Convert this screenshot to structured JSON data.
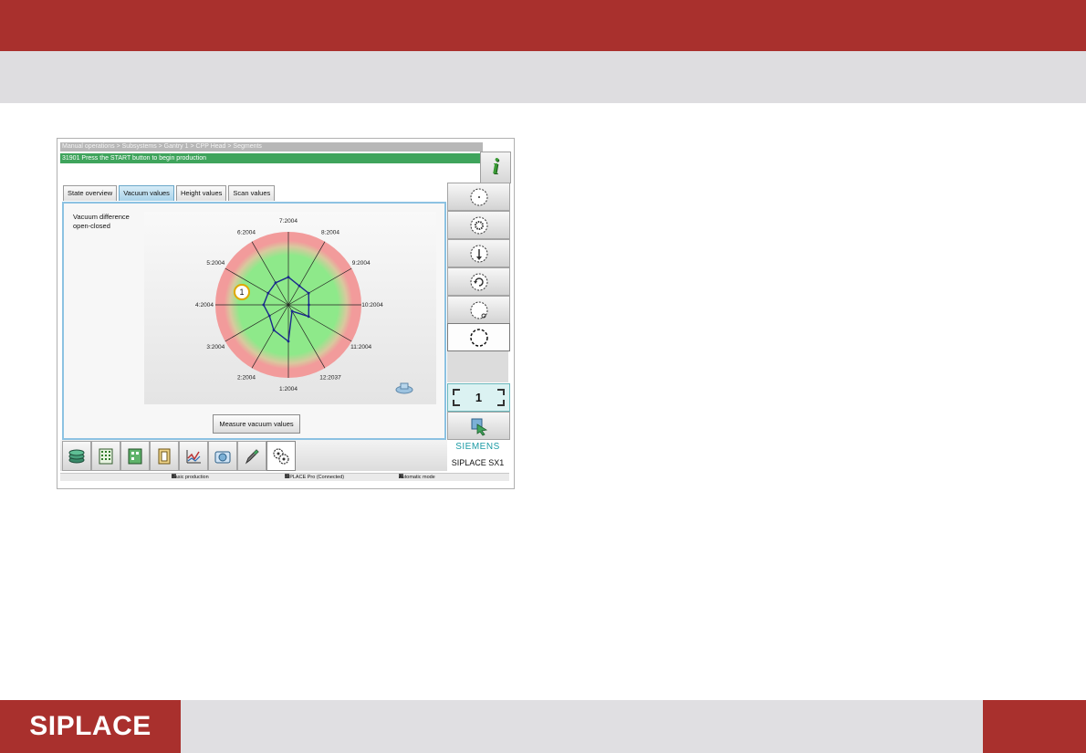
{
  "brand": {
    "logo_text": "SIPLACE",
    "accent": "#a9302d"
  },
  "screen": {
    "breadcrumb": "Manual operations > Subsystems > Gantry 1 > CPP Head > Segments",
    "status_message": "31901 Press the START button to begin production",
    "info_button_label": "i",
    "tabs": [
      {
        "label": "State overview",
        "active": false
      },
      {
        "label": "Vacuum values",
        "active": true
      },
      {
        "label": "Height values",
        "active": false
      },
      {
        "label": "Scan values",
        "active": false
      }
    ],
    "panel_label": "Vacuum difference open-closed",
    "measure_button": "Measure vacuum values",
    "counter_value": "1",
    "brand_siemens": "SIEMENS",
    "machine_name": "SIPLACE SX1",
    "status_bar": {
      "left": "Basic production",
      "middle": "SIPLACE Pro (Connected)",
      "right": "Automatic mode"
    },
    "toolbar_icons": [
      "stack-icon",
      "grid-icon",
      "feeder-icon",
      "door-icon",
      "chart-icon",
      "camera-icon",
      "pen-icon",
      "gear-icon"
    ],
    "side_icons": [
      "segment-icon",
      "gear-segment-icon",
      "nozzle-down-icon",
      "rotate-icon",
      "segment-search-icon",
      "segment-all-icon"
    ],
    "chart_data": {
      "type": "radar",
      "labels": [
        "7:2004",
        "8:2004",
        "9:2004",
        "10:2004",
        "11:2004",
        "12:2037",
        "1:2004",
        "2:2004",
        "3:2004",
        "4:2004",
        "5:2004",
        "6:2004"
      ],
      "values": [
        0.38,
        0.3,
        0.32,
        0.28,
        0.32,
        0.1,
        0.5,
        0.4,
        0.3,
        0.34,
        0.32,
        0.35
      ],
      "selected_segment": "1",
      "zones": [
        {
          "name": "ok",
          "color": "#8ee98a"
        },
        {
          "name": "error",
          "color": "#f29b9b"
        }
      ],
      "line_color": "#1a2a8c"
    }
  }
}
